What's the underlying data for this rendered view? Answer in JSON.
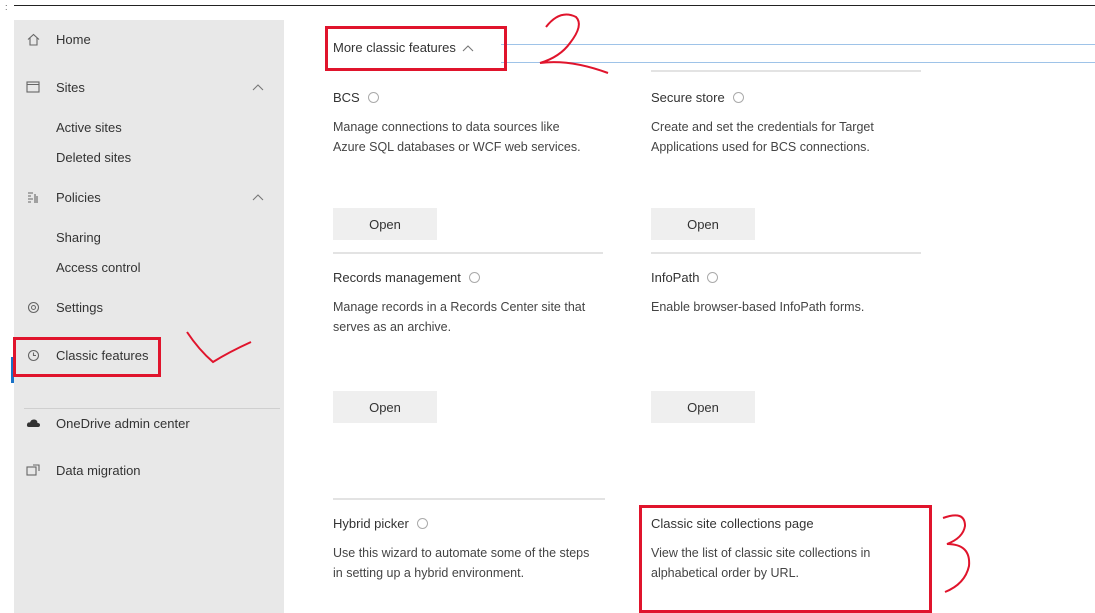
{
  "tick": ":",
  "sidebar": {
    "home": "Home",
    "sites": "Sites",
    "sites_children": [
      "Active sites",
      "Deleted sites"
    ],
    "policies": "Policies",
    "policies_children": [
      "Sharing",
      "Access control"
    ],
    "settings": "Settings",
    "classic_features": "Classic features",
    "onedrive": "OneDrive admin center",
    "data_migration": "Data migration"
  },
  "main": {
    "toggle_label": "More classic features",
    "cards": [
      {
        "title": "BCS",
        "desc": "Manage connections to data sources like Azure SQL databases or WCF web services.",
        "button": "Open"
      },
      {
        "title": "Secure store",
        "desc": "Create and set the credentials for Target Applications used for BCS connections.",
        "button": "Open"
      },
      {
        "title": "Records management",
        "desc": "Manage records in a Records Center site that serves as an archive.",
        "button": "Open"
      },
      {
        "title": "InfoPath",
        "desc": "Enable browser-based InfoPath forms.",
        "button": "Open"
      },
      {
        "title": "Hybrid picker",
        "desc": "Use this wizard to automate some of the steps in setting up a hybrid environment.",
        "button": ""
      },
      {
        "title": "Classic site collections page",
        "desc": "View the list of classic site collections in alphabetical order by URL.",
        "button": ""
      }
    ]
  },
  "colors": {
    "annotation_red": "#e0142c",
    "sidebar_bg": "#e8e8e8",
    "accent_blue": "#1a73c8"
  }
}
